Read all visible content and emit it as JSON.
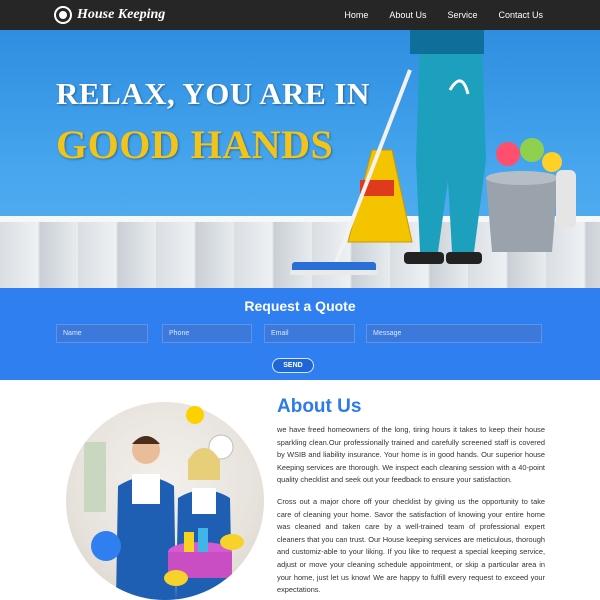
{
  "nav": {
    "logo_text": "House Keeping",
    "links": [
      "Home",
      "About Us",
      "Service",
      "Contact Us"
    ]
  },
  "hero": {
    "line1": "RELAX, YOU ARE IN",
    "line2": "GOOD HANDS"
  },
  "quote": {
    "title": "Request a Quote",
    "name_placeholder": "Name",
    "phone_placeholder": "Phone",
    "email_placeholder": "Email",
    "message_placeholder": "Message",
    "send_label": "SEND"
  },
  "about": {
    "title": "About Us",
    "p1": "we have freed homeowners of the long, tiring hours it takes to keep their house sparkling clean.Our professionally trained and carefully screened staff is covered by WSIB and liability insurance. Your home is in good hands. Our superior house Keeping services are thorough. We inspect each cleaning session with a 40-point quality checklist and seek out your feedback to ensure your satisfaction.",
    "p2": "Cross out a major chore off your checklist by giving us the opportunity to take care of cleaning your home. Savor the satisfaction of knowing your entire home was cleaned and taken care by a well-trained team of professional expert cleaners that you can trust. Our House keeping services are meticulous, thorough and customiz-able to your liking. If you like to request a special keeping service, adjust or move your cleaning schedule appointment, or skip a particular area in your home, just let us know! We are happy to fulfill every request to exceed your expectations."
  },
  "colors": {
    "nav_bg": "#262626",
    "brand_blue": "#2f7ff0",
    "accent_yellow": "#f2c41a"
  }
}
